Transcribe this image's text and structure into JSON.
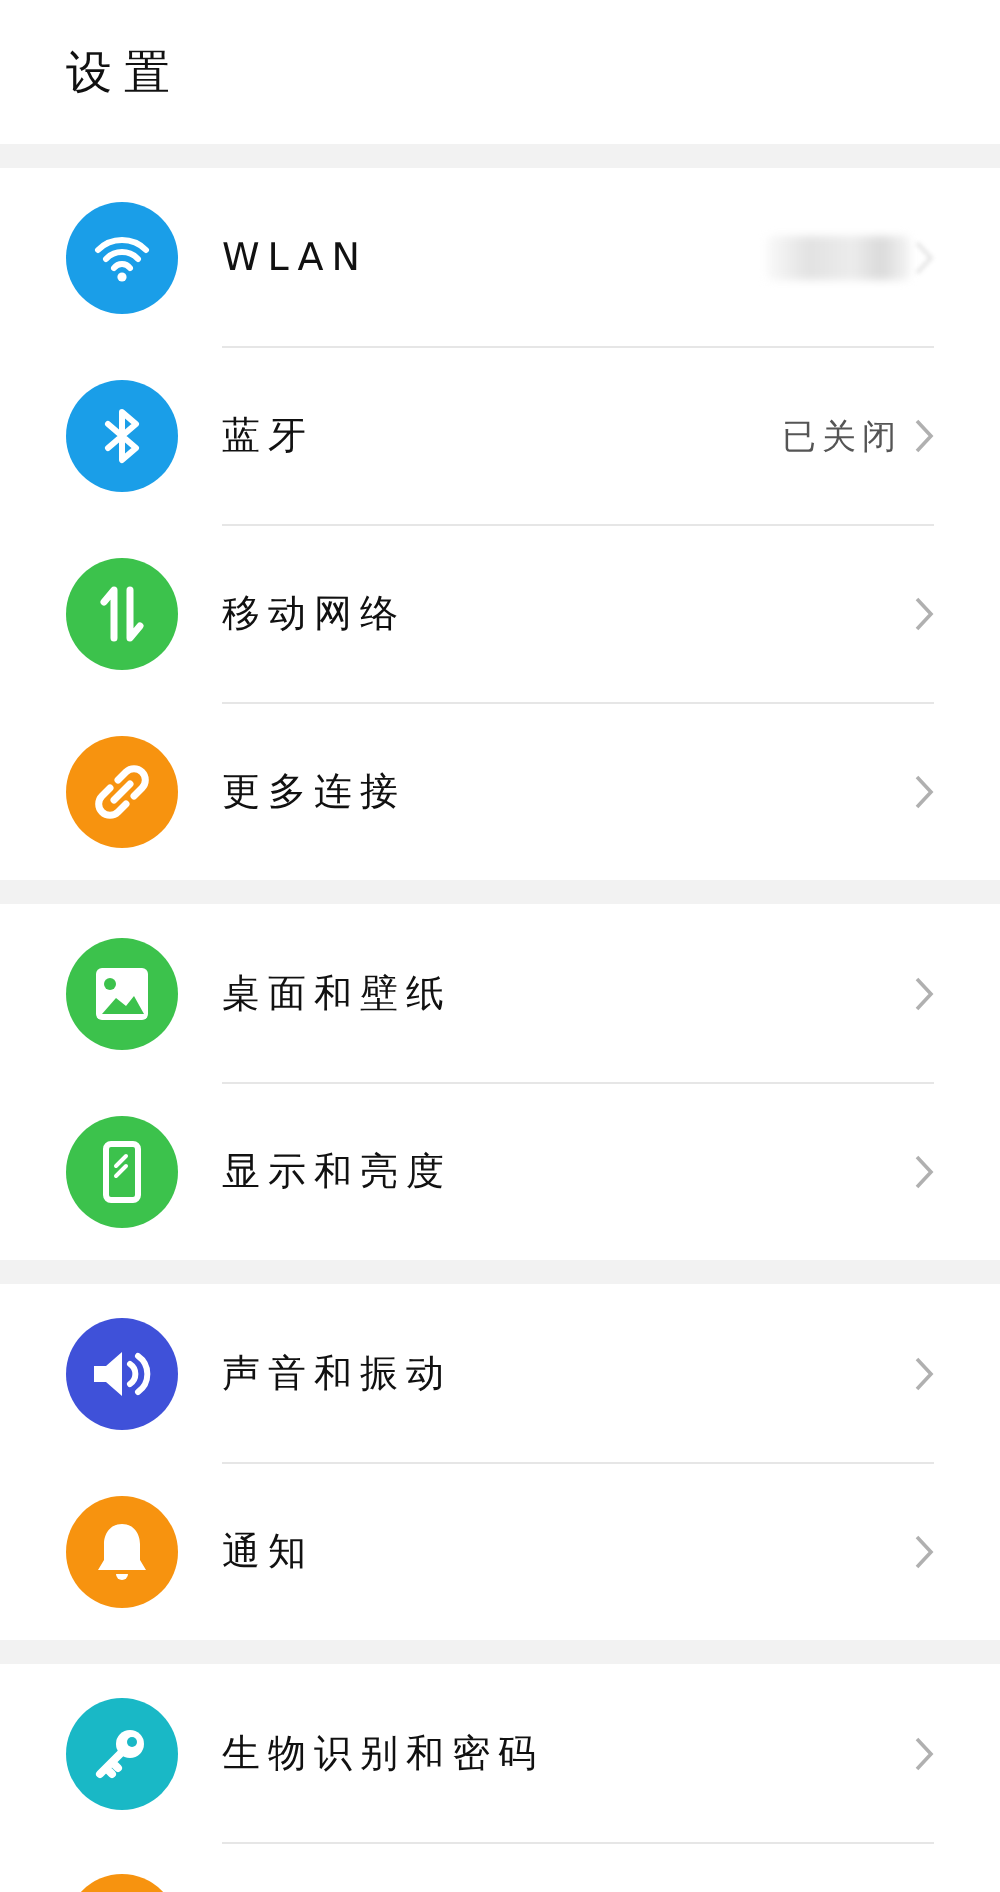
{
  "header": {
    "title": "设置"
  },
  "groups": [
    {
      "items": [
        {
          "label": "WLAN",
          "kind": "wifi",
          "color": "#1a9ee8",
          "value_redacted": true
        },
        {
          "label": "蓝牙",
          "kind": "bluetooth",
          "color": "#1a9ee8",
          "value": "已关闭"
        },
        {
          "label": "移动网络",
          "kind": "mobile",
          "color": "#3cc24c"
        },
        {
          "label": "更多连接",
          "kind": "connect",
          "color": "#f7930f"
        }
      ]
    },
    {
      "items": [
        {
          "label": "桌面和壁纸",
          "kind": "wallpaper",
          "color": "#3cc24c"
        },
        {
          "label": "显示和亮度",
          "kind": "display",
          "color": "#3cc24c"
        }
      ]
    },
    {
      "items": [
        {
          "label": "声音和振动",
          "kind": "sound",
          "color": "#3f51d9"
        },
        {
          "label": "通知",
          "kind": "notify",
          "color": "#f7930f"
        }
      ]
    },
    {
      "items": [
        {
          "label": "生物识别和密码",
          "kind": "security",
          "color": "#19b8c6"
        },
        {
          "kind": "partial",
          "color": "#f7930f"
        }
      ]
    }
  ]
}
